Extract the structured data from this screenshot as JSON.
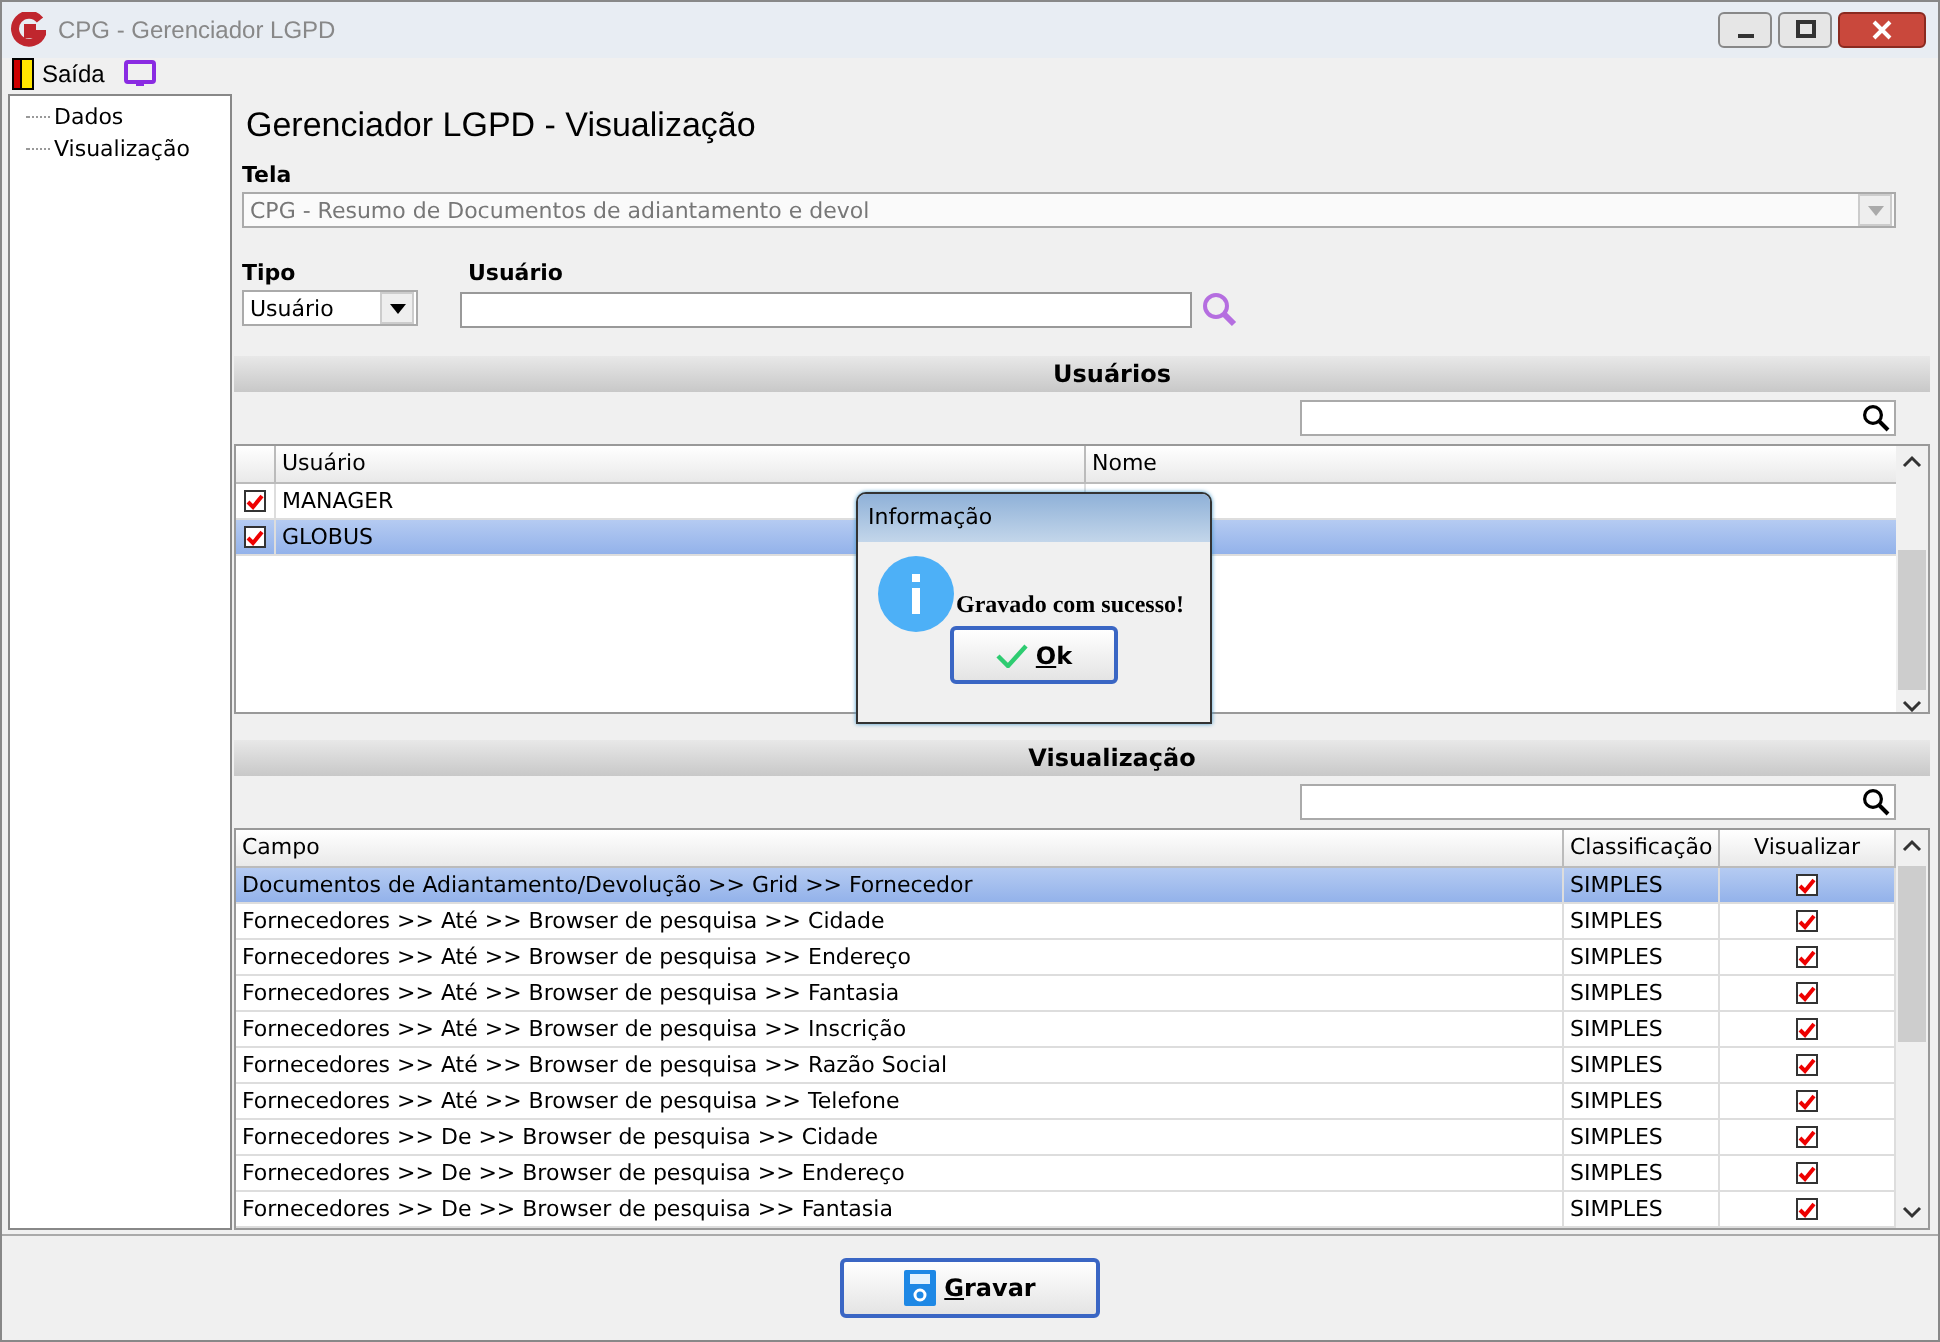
{
  "window": {
    "title": "CPG - Gerenciador LGPD"
  },
  "menu": [
    {
      "label": "Saída"
    }
  ],
  "tree": [
    {
      "label": "Dados"
    },
    {
      "label": "Visualização"
    }
  ],
  "heading": "Gerenciador LGPD - Visualização",
  "tela": {
    "label": "Tela",
    "value": "CPG - Resumo de Documentos de adiantamento e devol"
  },
  "tipo": {
    "label": "Tipo",
    "value": "Usuário"
  },
  "usuario": {
    "label": "Usuário"
  },
  "users": {
    "title": "Usuários",
    "columns": [
      "Usuário",
      "Nome"
    ],
    "rows": [
      {
        "usuario": "MANAGER",
        "checked": true,
        "selected": false
      },
      {
        "usuario": "GLOBUS",
        "checked": true,
        "selected": true
      }
    ]
  },
  "visualizacao": {
    "title": "Visualização",
    "columns": [
      "Campo",
      "Classificação",
      "Visualizar"
    ],
    "rows": [
      {
        "campo": "Documentos de Adiantamento/Devolução >> Grid >> Fornecedor",
        "classificacao": "SIMPLES",
        "visualizar": true,
        "selected": true
      },
      {
        "campo": "Fornecedores >> Até >> Browser de pesquisa >> Cidade",
        "classificacao": "SIMPLES",
        "visualizar": true,
        "selected": false
      },
      {
        "campo": "Fornecedores >> Até >> Browser de pesquisa >> Endereço",
        "classificacao": "SIMPLES",
        "visualizar": true,
        "selected": false
      },
      {
        "campo": "Fornecedores >> Até >> Browser de pesquisa >> Fantasia",
        "classificacao": "SIMPLES",
        "visualizar": true,
        "selected": false
      },
      {
        "campo": "Fornecedores >> Até >> Browser de pesquisa >> Inscrição",
        "classificacao": "SIMPLES",
        "visualizar": true,
        "selected": false
      },
      {
        "campo": "Fornecedores >> Até >> Browser de pesquisa >> Razão Social",
        "classificacao": "SIMPLES",
        "visualizar": true,
        "selected": false
      },
      {
        "campo": "Fornecedores >> Até >> Browser de pesquisa >> Telefone",
        "classificacao": "SIMPLES",
        "visualizar": true,
        "selected": false
      },
      {
        "campo": "Fornecedores >> De >> Browser de pesquisa >> Cidade",
        "classificacao": "SIMPLES",
        "visualizar": true,
        "selected": false
      },
      {
        "campo": "Fornecedores >> De >> Browser de pesquisa >> Endereço",
        "classificacao": "SIMPLES",
        "visualizar": true,
        "selected": false
      },
      {
        "campo": "Fornecedores >> De >> Browser de pesquisa >> Fantasia",
        "classificacao": "SIMPLES",
        "visualizar": true,
        "selected": false
      }
    ]
  },
  "dialog": {
    "title": "Informação",
    "message": "Gravado com sucesso!",
    "button": "Ok"
  },
  "save_button": "Gravar"
}
